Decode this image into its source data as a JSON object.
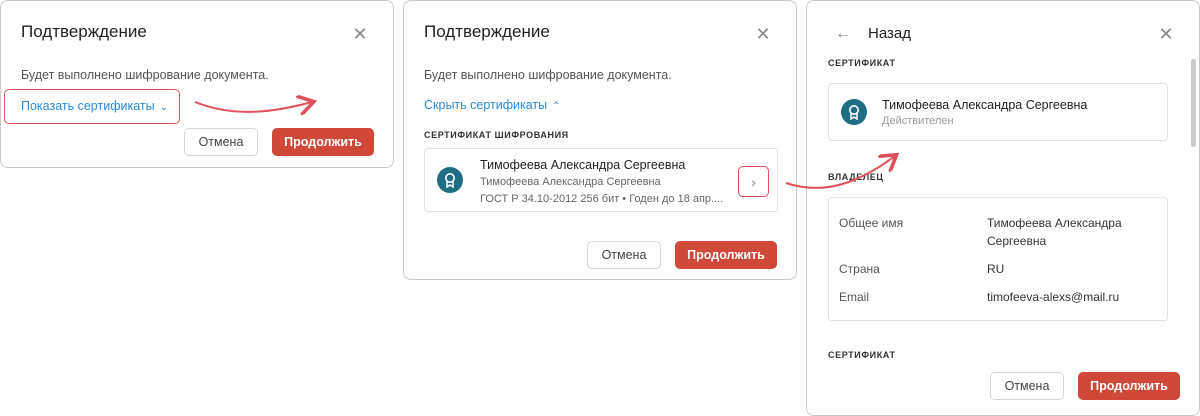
{
  "dialog1": {
    "title": "Подтверждение",
    "message": "Будет выполнено шифрование документа.",
    "toggle_link": "Показать сертификаты",
    "cancel_label": "Отмена",
    "continue_label": "Продолжить"
  },
  "dialog2": {
    "title": "Подтверждение",
    "message": "Будет выполнено шифрование документа.",
    "toggle_link": "Скрыть сертификаты",
    "section_label": "СЕРТИФИКАТ ШИФРОВАНИЯ",
    "certificate": {
      "name": "Тимофеева Александра Сергеевна",
      "subject": "Тимофеева Александра Сергеевна",
      "details": "ГОСТ Р 34.10-2012 256 бит • Годен до 18 апр...."
    },
    "cancel_label": "Отмена",
    "continue_label": "Продолжить"
  },
  "dialog3": {
    "back_label": "Назад",
    "certificate_section": "СЕРТИФИКАТ",
    "certificate": {
      "name": "Тимофеева Александра Сергеевна",
      "status": "Действителен"
    },
    "owner_section": "ВЛАДЕЛЕЦ",
    "owner": {
      "common_name_label": "Общее имя",
      "common_name_line1": "Тимофеева Александра",
      "common_name_line2": "Сергеевна",
      "country_label": "Страна",
      "country_value": "RU",
      "email_label": "Email",
      "email_value": "timofeeva-alexs@mail.ru"
    },
    "certificate_section2": "СЕРТИФИКАТ",
    "cancel_label": "Отмена",
    "continue_label": "Продолжить"
  },
  "icons": {
    "close": "close-icon",
    "back": "arrow-left-icon",
    "chevron_right": "chevron-right-icon",
    "certificate": "certificate-badge-icon"
  },
  "colors": {
    "primary": "#d04838",
    "link": "#2d8ad6",
    "highlight": "#e0505b",
    "cert_icon": "#1f6e84"
  }
}
